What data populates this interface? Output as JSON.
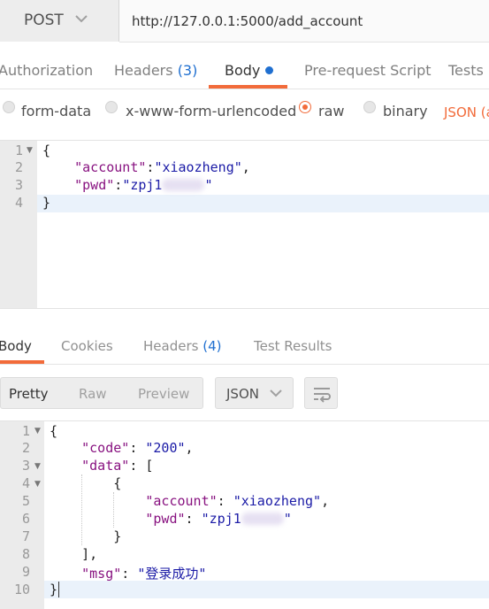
{
  "request": {
    "method": "POST",
    "url": "http://127.0.0.1:5000/add_account"
  },
  "request_tabs": [
    {
      "label": "Authorization"
    },
    {
      "label": "Headers",
      "count": "(3)"
    },
    {
      "label": "Body"
    },
    {
      "label": "Pre-request Script"
    },
    {
      "label": "Tests"
    }
  ],
  "body_types": [
    {
      "label": "form-data",
      "selected": false
    },
    {
      "label": "x-www-form-urlencoded",
      "selected": false
    },
    {
      "label": "raw",
      "selected": true
    },
    {
      "label": "binary",
      "selected": false
    }
  ],
  "raw_type": "JSON (a",
  "request_body": {
    "line_numbers": [
      "1",
      "2",
      "3",
      "4"
    ],
    "open_brace": "{",
    "account_key": "\"account\"",
    "account_value": "\"xiaozheng\"",
    "pwd_key": "\"pwd\"",
    "pwd_value_visible": "\"zpj1",
    "pwd_value_end": "\"",
    "close_brace": "}"
  },
  "response_tabs": [
    {
      "label": "Body"
    },
    {
      "label": "Cookies"
    },
    {
      "label": "Headers",
      "count": "(4)"
    },
    {
      "label": "Test Results"
    }
  ],
  "view_modes": [
    "Pretty",
    "Raw",
    "Preview"
  ],
  "format": "JSON",
  "response_body": {
    "line_numbers": [
      "1",
      "2",
      "3",
      "4",
      "5",
      "6",
      "7",
      "8",
      "9",
      "10"
    ],
    "open_brace": "{",
    "code_key": "\"code\"",
    "code_value": "\"200\"",
    "data_key": "\"data\"",
    "open_bracket": "[",
    "inner_open": "{",
    "account_key": "\"account\"",
    "account_value": "\"xiaozheng\"",
    "pwd_key": "\"pwd\"",
    "pwd_value_visible": "\"zpj1",
    "pwd_value_end": "\"",
    "inner_close": "}",
    "close_bracket": "],",
    "msg_key": "\"msg\"",
    "msg_value": "\"登录成功\"",
    "close_brace": "}"
  },
  "colors": {
    "accent": "#f26b3a",
    "count_blue": "#1f6fd0",
    "json_key": "#881280",
    "json_string": "#1a1aa6"
  }
}
